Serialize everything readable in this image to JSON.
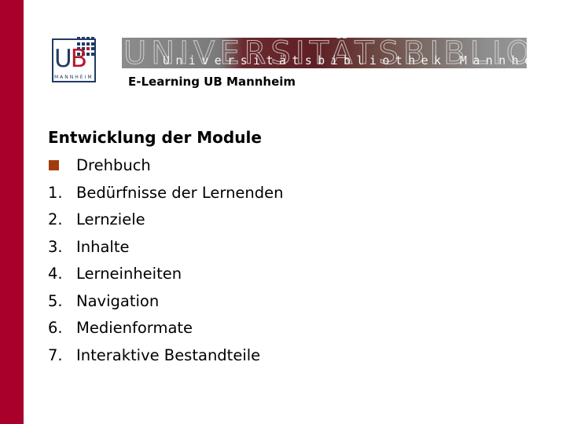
{
  "branding": {
    "logo": {
      "letters_u": "U",
      "letters_b": "B",
      "caption": "MANNHEIM",
      "primary_color": "#1f3b63",
      "accent_color": "#b3182e"
    },
    "banner": {
      "big_text": "UNIVERSITÄTSBIBLIOTHEK",
      "small_text": "Universitätsbibliothek Mannheim"
    },
    "subtitle": "E-Learning UB Mannheim",
    "sidebar_color": "#a8002a"
  },
  "slide": {
    "heading": "Entwicklung der Module",
    "items": [
      {
        "marker": "square-bullet",
        "text": "Drehbuch"
      },
      {
        "marker": "1.",
        "text": "Bedürfnisse der Lernenden"
      },
      {
        "marker": "2.",
        "text": "Lernziele"
      },
      {
        "marker": "3.",
        "text": "Inhalte"
      },
      {
        "marker": "4.",
        "text": "Lerneinheiten"
      },
      {
        "marker": "5.",
        "text": "Navigation"
      },
      {
        "marker": "6.",
        "text": "Medienformate"
      },
      {
        "marker": "7.",
        "text": "Interaktive Bestandteile"
      }
    ],
    "bullet_color": "#a33a0c"
  }
}
